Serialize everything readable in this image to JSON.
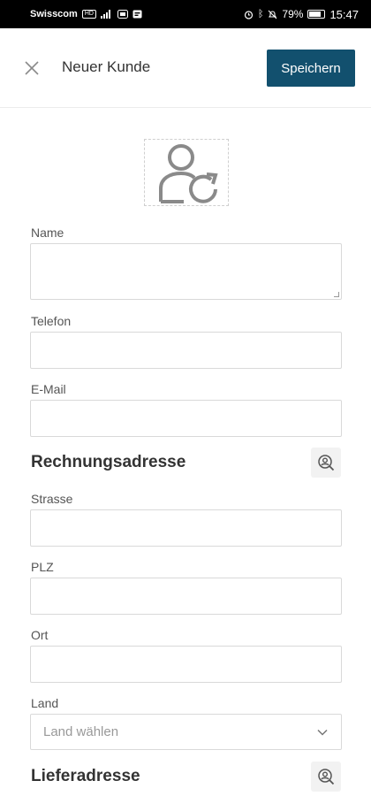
{
  "status_bar": {
    "carrier": "Swisscom",
    "network_badge": "HD",
    "battery_percent": "79%",
    "battery_level": 0.79,
    "time": "15:47"
  },
  "header": {
    "title": "Neuer Kunde",
    "save_label": "Speichern",
    "close_icon": "close-icon"
  },
  "avatar": {
    "icon": "user-refresh-icon"
  },
  "fields": {
    "name": {
      "label": "Name",
      "value": ""
    },
    "telefon": {
      "label": "Telefon",
      "value": ""
    },
    "email": {
      "label": "E-Mail",
      "value": ""
    }
  },
  "billing": {
    "title": "Rechnungsadresse",
    "lookup_icon": "contact-search-icon",
    "strasse": {
      "label": "Strasse",
      "value": ""
    },
    "plz": {
      "label": "PLZ",
      "value": ""
    },
    "ort": {
      "label": "Ort",
      "value": ""
    },
    "land": {
      "label": "Land",
      "placeholder": "Land wählen"
    }
  },
  "shipping": {
    "title": "Lieferadresse",
    "lookup_icon": "contact-search-icon"
  },
  "colors": {
    "primary": "#12506e",
    "border": "#d9d9d9",
    "text": "#333333",
    "muted": "#999999"
  }
}
